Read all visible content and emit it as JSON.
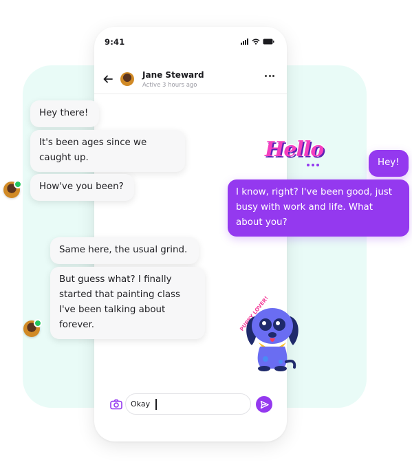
{
  "status_bar": {
    "time": "9:41"
  },
  "header": {
    "contact_name": "Jane Steward",
    "contact_status": "Active 3 hours ago"
  },
  "messages": [
    {
      "side": "incoming",
      "text": "Hey there!"
    },
    {
      "side": "incoming",
      "text": "It's been ages since we caught up."
    },
    {
      "side": "incoming",
      "text": "How've you been?"
    },
    {
      "side": "outgoing",
      "text": "Hey!"
    },
    {
      "side": "outgoing",
      "text": "I know, right? I've been good, just busy with work and life. What about you?"
    },
    {
      "side": "incoming",
      "text": "Same here, the usual grind."
    },
    {
      "side": "incoming",
      "text": "But guess what? I finally started that painting class I've been talking about forever."
    }
  ],
  "stickers": {
    "hello": "Hello",
    "puppy": "PUPPY LOVER!"
  },
  "composer": {
    "value": "Okay"
  },
  "colors": {
    "accent": "#9439ef",
    "panel_background": "#e9fbf7",
    "online": "#22c55e"
  },
  "icons": [
    "back-arrow-icon",
    "more-icon",
    "camera-icon",
    "send-icon",
    "signal-icon",
    "wifi-icon",
    "battery-icon"
  ]
}
